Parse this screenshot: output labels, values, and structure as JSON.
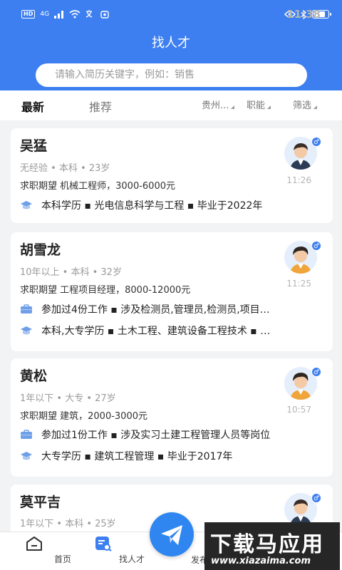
{
  "status_bar": {
    "hd": "HD",
    "signal": "4G",
    "time": "11:38",
    "battery_level": 0.85
  },
  "header": {
    "title": "找人才",
    "search_placeholder": "请输入简历关键字，例如：销售"
  },
  "tabs": [
    {
      "label": "最新",
      "active": true
    },
    {
      "label": "推荐",
      "active": false
    }
  ],
  "filters": [
    "贵州...",
    "职能",
    "筛选"
  ],
  "cards": [
    {
      "name": "吴猛",
      "meta": "无经验 • 本科 • 23岁",
      "expect": "求职期望 机械工程师，3000-6000元",
      "time": "11:26",
      "lines": [
        {
          "icon": "graduation-cap-icon",
          "text": "本科学历 ▪ 光电信息科学与工程 ▪ 毕业于2022年"
        }
      ]
    },
    {
      "name": "胡雪龙",
      "meta": "10年以上 • 本科 • 32岁",
      "expect": "求职期望 工程项目经理，8000-12000元",
      "time": "11:25",
      "lines": [
        {
          "icon": "briefcase-icon",
          "text": "参加过4份工作 ▪ 涉及检测员,管理员,检测员,项目…"
        },
        {
          "icon": "graduation-cap-icon",
          "text": "本科,大专学历 ▪ 土木工程、建筑设备工程技术 ▪ …"
        }
      ]
    },
    {
      "name": "黄松",
      "meta": "1年以下 • 大专 • 27岁",
      "expect": "求职期望 建筑，2000-3000元",
      "time": "10:57",
      "lines": [
        {
          "icon": "briefcase-icon",
          "text": "参加过1份工作 ▪ 涉及实习土建工程管理人员等岗位"
        },
        {
          "icon": "graduation-cap-icon",
          "text": "大专学历 ▪ 建筑工程管理 ▪ 毕业于2017年"
        }
      ]
    },
    {
      "name": "莫平吉",
      "meta": "1年以下 • 本科 • 25岁"
    }
  ],
  "bottom_nav": [
    {
      "label": "首页",
      "icon": "home-icon"
    },
    {
      "label": "找人才",
      "icon": "talent-search-icon"
    },
    {
      "label": "发布",
      "icon": "paper-plane-icon"
    }
  ],
  "watermark": {
    "big": "下载马应用",
    "small": "www.xiazaima.com"
  },
  "colors": {
    "primary": "#3d7ff0",
    "fab": "#2f86f0"
  }
}
